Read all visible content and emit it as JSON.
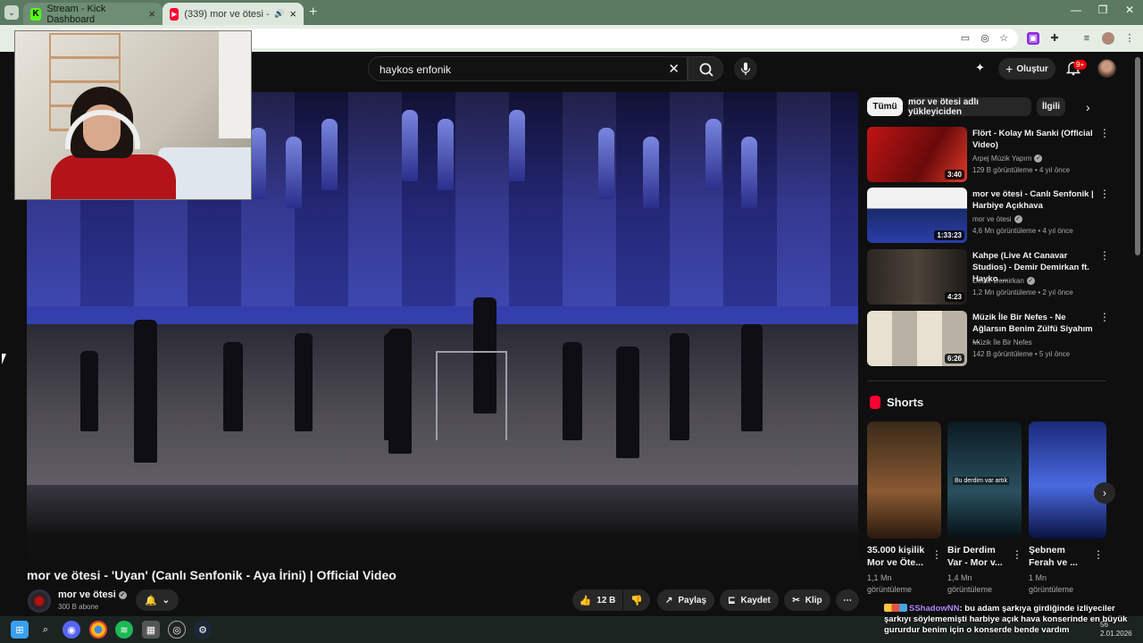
{
  "browser": {
    "tabs": [
      {
        "title": "Stream - Kick Dashboard",
        "active": false
      },
      {
        "title": "(339) mor ve ötesi - 'Uyan'",
        "active": true
      }
    ]
  },
  "header": {
    "search_query": "haykos enfonik",
    "create_label": "Oluştur",
    "notification_badge": "9+"
  },
  "video": {
    "title": "mor ve ötesi - 'Uyan' (Canlı Senfonik - Aya İrini) | Official Video",
    "channel_name": "mor ve ötesi",
    "subscribers": "300 B abone",
    "likes": "12 B",
    "share_label": "Paylaş",
    "save_label": "Kaydet",
    "clip_label": "Klip"
  },
  "chips": [
    "Tümü",
    "mor ve ötesi adlı yükleyiciden",
    "İlgili"
  ],
  "recommendations": [
    {
      "title": "Flört - Kolay Mı Sanki (Official Video)",
      "channel": "Arpej Müzik Yapım",
      "meta": "129 B görüntüleme • 4 yıl önce",
      "duration": "3:40"
    },
    {
      "title": "mor ve ötesi - Canlı Senfonik | Harbiye Açıkhava",
      "channel": "mor ve ötesi",
      "meta": "4,6 Mn görüntüleme • 4 yıl önce",
      "duration": "1:33:23"
    },
    {
      "title": "Kahpe (Live At Canavar Studios) - Demir Demirkan ft.  Hayko ...",
      "channel": "Demir Demirkan",
      "meta": "1,2 Mn görüntüleme • 2 yıl önce",
      "duration": "4:23"
    },
    {
      "title": "Müzik İle Bir Nefes - Ne Ağlarsın Benim Zülfü Siyahım ...",
      "channel": "Müzik İle Bir Nefes",
      "meta": "142 B görüntüleme • 5 yıl önce",
      "duration": "6:26"
    }
  ],
  "shorts": {
    "heading": "Shorts",
    "items": [
      {
        "title": "35.000 kişilik Mor ve Öte...",
        "views_line1": "1,1 Mn",
        "views_line2": "görüntüleme"
      },
      {
        "title": "Bir Derdim Var - Mor v...",
        "views_line1": "1,4 Mn",
        "views_line2": "görüntüleme",
        "caption": "Bu derdim var artık"
      },
      {
        "title": "Şebnem Ferah ve ...",
        "views_line1": "1 Mn",
        "views_line2": "görüntüleme"
      }
    ]
  },
  "chat": {
    "user": "SShadowNN",
    "message": ": bu adam şarkıya girdiğinde izliyeciler şarkıyı söylememişti harbiye açık hava konserinde en büyük gururdur benim için o konserde bende vardım"
  },
  "taskbar": {
    "time": "56",
    "date": "2.01.2026"
  },
  "colors": {
    "youtube_red": "#ff0033",
    "page_bg": "#0f0f0f",
    "chrome_frame": "#5b7a62"
  }
}
